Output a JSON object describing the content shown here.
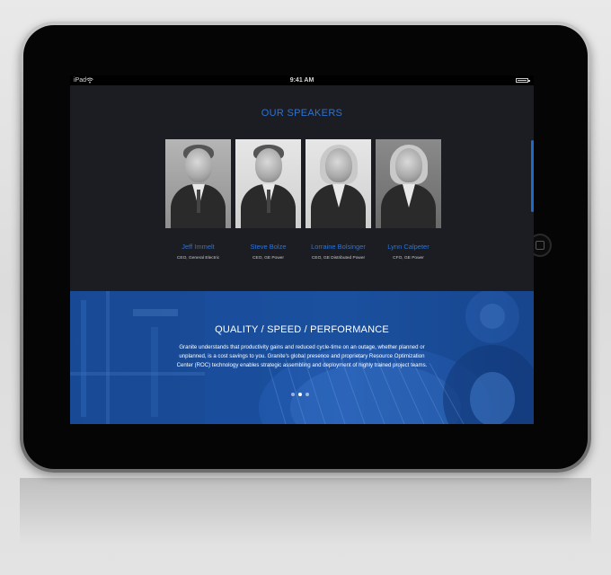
{
  "status_bar": {
    "carrier": "iPad",
    "wifi_icon": "wifi-icon",
    "time": "9:41 AM",
    "battery_icon": "battery-icon"
  },
  "speakers_section": {
    "title": "OUR SPEAKERS",
    "speakers": [
      {
        "name": "Jeff Immelt",
        "role": "CEO, General Electric"
      },
      {
        "name": "Steve Bolze",
        "role": "CEO, GE Power"
      },
      {
        "name": "Lorraine Bolsinger",
        "role": "CEO, GE Distributed Power"
      },
      {
        "name": "Lynn Calpeter",
        "role": "CFO, GE Power"
      }
    ]
  },
  "banner": {
    "heading": "QUALITY / SPEED / PERFORMANCE",
    "body": "Granite understands that productivity gains and reduced cycle-time on an outage, whether planned or unplanned, is a cost savings to you. Granite's global presence and proprietary Resource Optimization Center (ROC) technology enables strategic assembling and deployment of highly trained project teams.",
    "carousel": {
      "slide_count": 3,
      "active_index": 1
    }
  },
  "colors": {
    "accent": "#2b73d6",
    "screen_background": "#1c1d22",
    "banner_blue": "#1b4f9b"
  }
}
